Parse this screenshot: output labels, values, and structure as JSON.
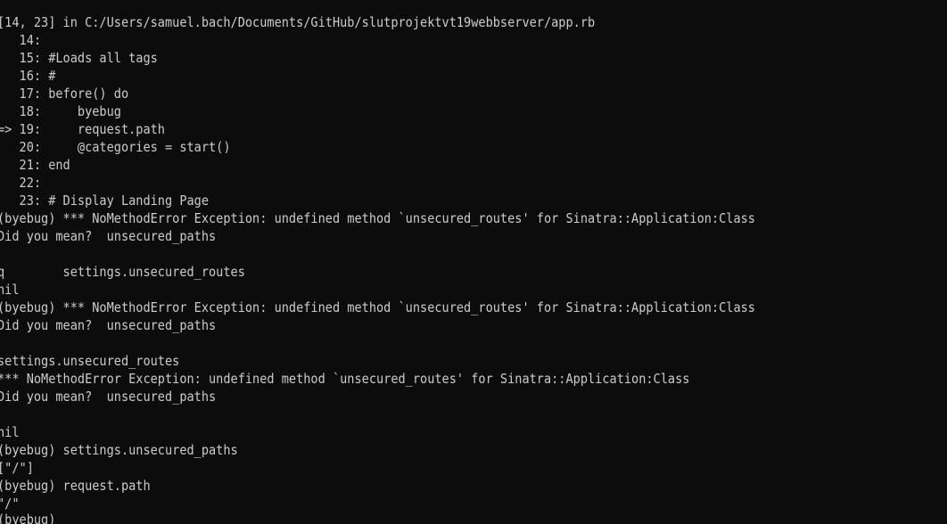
{
  "terminal": {
    "background": "#0c0c0c",
    "foreground": "#cccccc",
    "lines": [
      "[14, 23] in C:/Users/samuel.bach/Documents/GitHub/slutprojektvt19webbserver/app.rb",
      "   14:",
      "   15: #Loads all tags",
      "   16: #",
      "   17: before() do",
      "   18:     byebug",
      "=> 19:     request.path",
      "   20:     @categories = start()",
      "   21: end",
      "   22:",
      "   23: # Display Landing Page",
      "(byebug) *** NoMethodError Exception: undefined method `unsecured_routes' for Sinatra::Application:Class",
      "Did you mean?  unsecured_paths",
      "",
      "q        settings.unsecured_routes",
      "nil",
      "(byebug) *** NoMethodError Exception: undefined method `unsecured_routes' for Sinatra::Application:Class",
      "Did you mean?  unsecured_paths",
      "",
      "settings.unsecured_routes",
      "*** NoMethodError Exception: undefined method `unsecured_routes' for Sinatra::Application:Class",
      "Did you mean?  unsecured_paths",
      "",
      "nil",
      "(byebug) settings.unsecured_paths",
      "[\"/\"]",
      "(byebug) request.path",
      "\"/\"",
      "(byebug)"
    ]
  }
}
